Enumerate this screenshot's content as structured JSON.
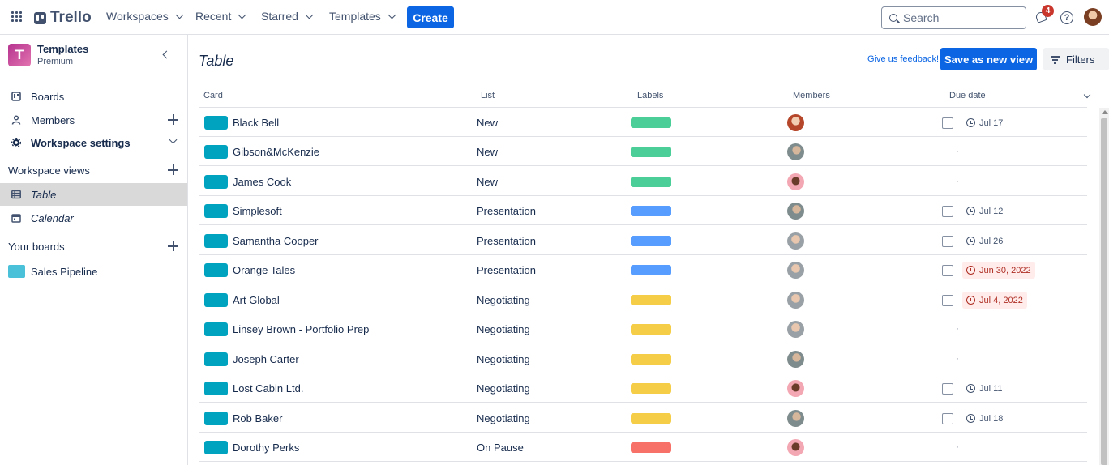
{
  "header": {
    "brand": "Trello",
    "nav": [
      "Workspaces",
      "Recent",
      "Starred",
      "Templates"
    ],
    "create_label": "Create",
    "search_placeholder": "Search",
    "notification_count": "4",
    "help_label": "?"
  },
  "sidebar": {
    "workspace_initial": "T",
    "workspace_name": "Templates",
    "workspace_plan": "Premium",
    "items": [
      {
        "label": "Boards",
        "icon": "board-icon"
      },
      {
        "label": "Members",
        "icon": "person-icon"
      },
      {
        "label": "Workspace settings",
        "icon": "gear-icon"
      }
    ],
    "views_title": "Workspace views",
    "views": [
      {
        "label": "Table",
        "icon": "table-icon",
        "active": true
      },
      {
        "label": "Calendar",
        "icon": "calendar-icon",
        "active": false
      }
    ],
    "boards_title": "Your boards",
    "boards": [
      {
        "label": "Sales Pipeline",
        "color": "#4bc0d9"
      }
    ]
  },
  "main": {
    "title": "Table",
    "feedback_label": "Give us feedback!",
    "save_view_label": "Save as new view",
    "filters_label": "Filters",
    "columns": [
      "Card",
      "List",
      "Labels",
      "Members",
      "Due date"
    ],
    "rows": [
      {
        "card": "Black Bell",
        "list": "New",
        "label_color": "#4bce97",
        "avatar": "av-a",
        "due": "Jul 17",
        "overdue": false
      },
      {
        "card": "Gibson&McKenzie",
        "list": "New",
        "label_color": "#4bce97",
        "avatar": "av-b",
        "due": "",
        "overdue": false
      },
      {
        "card": "James Cook",
        "list": "New",
        "label_color": "#4bce97",
        "avatar": "av-c",
        "due": "",
        "overdue": false
      },
      {
        "card": "Simplesoft",
        "list": "Presentation",
        "label_color": "#579dff",
        "avatar": "av-b",
        "due": "Jul 12",
        "overdue": false
      },
      {
        "card": "Samantha Cooper",
        "list": "Presentation",
        "label_color": "#579dff",
        "avatar": "av-d",
        "due": "Jul 26",
        "overdue": false
      },
      {
        "card": "Orange Tales",
        "list": "Presentation",
        "label_color": "#579dff",
        "avatar": "av-d",
        "due": "Jun 30, 2022",
        "overdue": true
      },
      {
        "card": "Art Global",
        "list": "Negotiating",
        "label_color": "#f5cd47",
        "avatar": "av-d",
        "due": "Jul 4, 2022",
        "overdue": true
      },
      {
        "card": "Linsey Brown - Portfolio Prep",
        "list": "Negotiating",
        "label_color": "#f5cd47",
        "avatar": "av-d",
        "due": "",
        "overdue": false
      },
      {
        "card": "Joseph Carter",
        "list": "Negotiating",
        "label_color": "#f5cd47",
        "avatar": "av-b",
        "due": "",
        "overdue": false
      },
      {
        "card": "Lost Cabin Ltd.",
        "list": "Negotiating",
        "label_color": "#f5cd47",
        "avatar": "av-c",
        "due": "Jul 11",
        "overdue": false
      },
      {
        "card": "Rob Baker",
        "list": "Negotiating",
        "label_color": "#f5cd47",
        "avatar": "av-b",
        "due": "Jul 18",
        "overdue": false
      },
      {
        "card": "Dorothy Perks",
        "list": "On Pause",
        "label_color": "#f87168",
        "avatar": "av-c",
        "due": "",
        "overdue": false
      }
    ],
    "empty_due_mark": "·"
  }
}
